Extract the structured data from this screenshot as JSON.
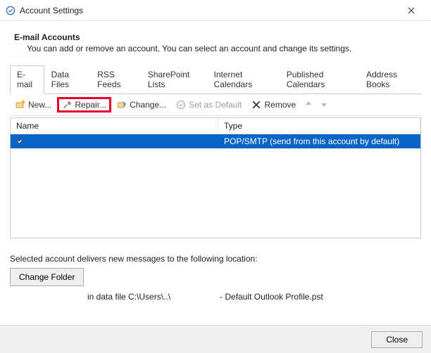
{
  "window": {
    "title": "Account Settings"
  },
  "header": {
    "title": "E-mail Accounts",
    "subtitle": "You can add or remove an account. You can select an account and change its settings."
  },
  "tabs": {
    "items": [
      {
        "label": "E-mail"
      },
      {
        "label": "Data Files"
      },
      {
        "label": "RSS Feeds"
      },
      {
        "label": "SharePoint Lists"
      },
      {
        "label": "Internet Calendars"
      },
      {
        "label": "Published Calendars"
      },
      {
        "label": "Address Books"
      }
    ]
  },
  "toolbar": {
    "new": "New...",
    "repair": "Repair...",
    "change": "Change...",
    "set_default": "Set as Default",
    "remove": "Remove"
  },
  "list": {
    "col_name": "Name",
    "col_type": "Type",
    "rows": [
      {
        "name": "",
        "type": "POP/SMTP (send from this account by default)"
      }
    ]
  },
  "delivery": {
    "label": "Selected account delivers new messages to the following location:",
    "change_folder": "Change Folder",
    "path_prefix": "in data file C:\\Users\\..\\",
    "path_suffix": "- Default Outlook Profile.pst"
  },
  "footer": {
    "close": "Close"
  }
}
